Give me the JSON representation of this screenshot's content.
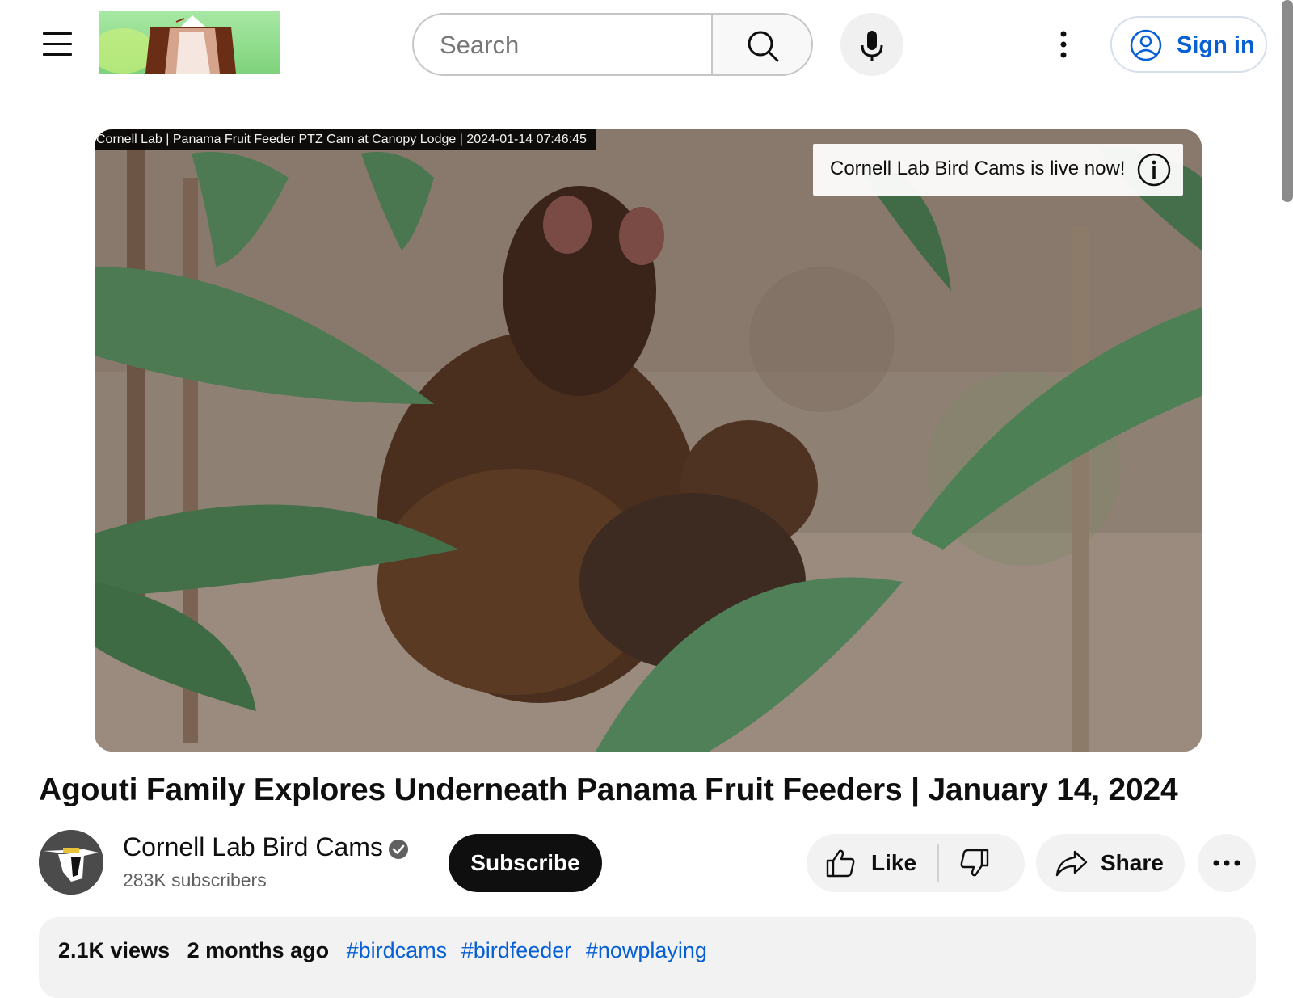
{
  "header": {
    "search_placeholder": "Search",
    "sign_in_label": "Sign in",
    "icons": [
      "menu-icon",
      "search-icon",
      "mic-icon",
      "more-vert-icon",
      "account-icon"
    ]
  },
  "player": {
    "stream_overlay": "Cornell Lab | Panama Fruit Feeder PTZ Cam at Canopy Lodge | 2024-01-14  07:46:45",
    "live_banner": "Cornell Lab Bird Cams is live now!"
  },
  "video": {
    "title": "Agouti Family Explores Underneath Panama Fruit Feeders | January 14, 2024"
  },
  "channel": {
    "name": "Cornell Lab Bird Cams",
    "verified": true,
    "subscribers": "283K subscribers"
  },
  "actions": {
    "subscribe": "Subscribe",
    "like": "Like",
    "share": "Share"
  },
  "description": {
    "views": "2.1K views",
    "age": "2 months ago",
    "hashtags": [
      "#birdcams",
      "#birdfeeder",
      "#nowplaying"
    ]
  },
  "colors": {
    "accent_link": "#065fd4",
    "subscribe_bg": "#0f0f0f",
    "chip_bg": "#f2f2f2"
  }
}
